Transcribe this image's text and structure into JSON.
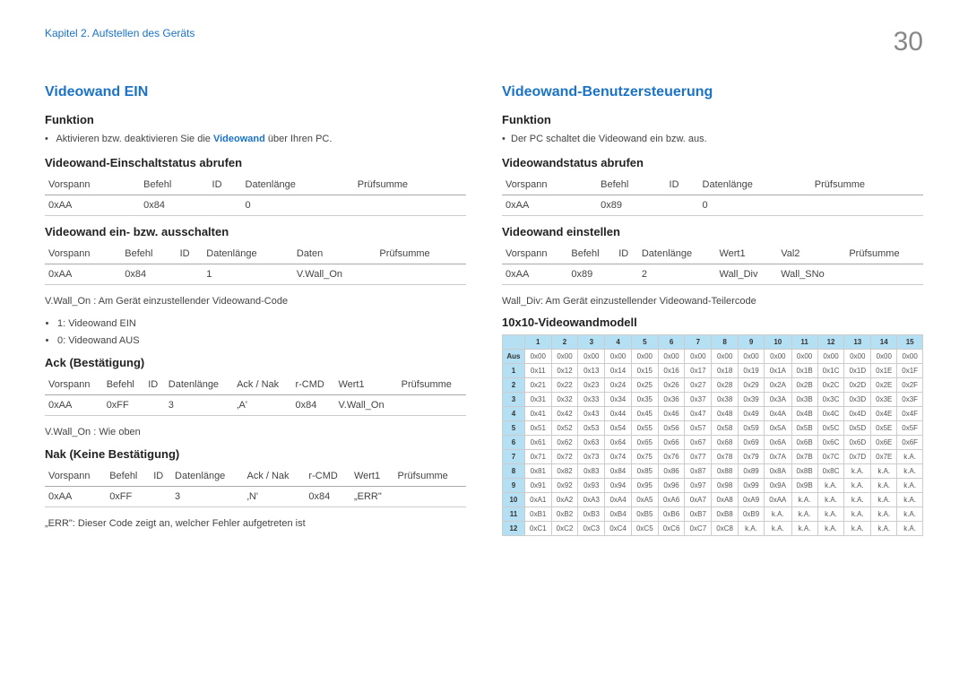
{
  "header": {
    "chapter": "Kapitel 2. Aufstellen des Geräts",
    "page_number": "30"
  },
  "left": {
    "title": "Videowand EIN",
    "funktion_label": "Funktion",
    "funktion_text_pre": "Aktivieren bzw. deaktivieren Sie die ",
    "funktion_link": "Videowand",
    "funktion_text_post": " über Ihren PC.",
    "status_heading": "Videowand-Einschaltstatus abrufen",
    "tbl_status_h": {
      "c1": "Vorspann",
      "c2": "Befehl",
      "c3": "ID",
      "c4": "Datenlänge",
      "c5": "Prüfsumme"
    },
    "tbl_status_r": {
      "c1": "0xAA",
      "c2": "0x84",
      "c3": "",
      "c4": "0",
      "c5": ""
    },
    "onoff_heading": "Videowand ein- bzw. ausschalten",
    "tbl_onoff_h": {
      "c1": "Vorspann",
      "c2": "Befehl",
      "c3": "ID",
      "c4": "Datenlänge",
      "c5": "Daten",
      "c6": "Prüfsumme"
    },
    "tbl_onoff_r": {
      "c1": "0xAA",
      "c2": "0x84",
      "c3": "",
      "c4": "1",
      "c5": "V.Wall_On",
      "c6": ""
    },
    "vwall_note": "V.Wall_On : Am Gerät einzustellender Videowand-Code",
    "bul1": "1: Videowand EIN",
    "bul0": "0: Videowand AUS",
    "ack_heading": "Ack (Bestätigung)",
    "tbl_ack_h": {
      "c1": "Vorspann",
      "c2": "Befehl",
      "c3": "ID",
      "c4": "Datenlänge",
      "c5": "Ack / Nak",
      "c6": "r-CMD",
      "c7": "Wert1",
      "c8": "Prüfsumme"
    },
    "tbl_ack_r": {
      "c1": "0xAA",
      "c2": "0xFF",
      "c3": "",
      "c4": "3",
      "c5": "‚A'",
      "c6": "0x84",
      "c7": "V.Wall_On",
      "c8": ""
    },
    "vwall_above": "V.Wall_On : Wie oben",
    "nak_heading": "Nak (Keine Bestätigung)",
    "tbl_nak_h": {
      "c1": "Vorspann",
      "c2": "Befehl",
      "c3": "ID",
      "c4": "Datenlänge",
      "c5": "Ack / Nak",
      "c6": "r-CMD",
      "c7": "Wert1",
      "c8": "Prüfsumme"
    },
    "tbl_nak_r": {
      "c1": "0xAA",
      "c2": "0xFF",
      "c3": "",
      "c4": "3",
      "c5": "‚N'",
      "c6": "0x84",
      "c7": "„ERR\"",
      "c8": ""
    },
    "err_note": "„ERR\": Dieser Code zeigt an, welcher Fehler aufgetreten ist"
  },
  "right": {
    "title": "Videowand-Benutzersteuerung",
    "funktion_label": "Funktion",
    "funktion_text": "Der PC schaltet die Videowand ein bzw. aus.",
    "status_heading": "Videowandstatus abrufen",
    "tbl_status_h": {
      "c1": "Vorspann",
      "c2": "Befehl",
      "c3": "ID",
      "c4": "Datenlänge",
      "c5": "Prüfsumme"
    },
    "tbl_status_r": {
      "c1": "0xAA",
      "c2": "0x89",
      "c3": "",
      "c4": "0",
      "c5": ""
    },
    "set_heading": "Videowand einstellen",
    "tbl_set_h": {
      "c1": "Vorspann",
      "c2": "Befehl",
      "c3": "ID",
      "c4": "Datenlänge",
      "c5": "Wert1",
      "c6": "Val2",
      "c7": "Prüfsumme"
    },
    "tbl_set_r": {
      "c1": "0xAA",
      "c2": "0x89",
      "c3": "",
      "c4": "2",
      "c5": "Wall_Div",
      "c6": "Wall_SNo",
      "c7": ""
    },
    "walldiv_note": "Wall_Div: Am Gerät einzustellender Videowand-Teilercode",
    "model_heading": "10x10-Videowandmodell"
  },
  "chart_data": {
    "type": "table",
    "title": "10x10-Videowandmodell",
    "columns": [
      "1",
      "2",
      "3",
      "4",
      "5",
      "6",
      "7",
      "8",
      "9",
      "10",
      "11",
      "12",
      "13",
      "14",
      "15"
    ],
    "rows": [
      {
        "label": "Aus",
        "cells": [
          "0x00",
          "0x00",
          "0x00",
          "0x00",
          "0x00",
          "0x00",
          "0x00",
          "0x00",
          "0x00",
          "0x00",
          "0x00",
          "0x00",
          "0x00",
          "0x00",
          "0x00"
        ]
      },
      {
        "label": "1",
        "cells": [
          "0x11",
          "0x12",
          "0x13",
          "0x14",
          "0x15",
          "0x16",
          "0x17",
          "0x18",
          "0x19",
          "0x1A",
          "0x1B",
          "0x1C",
          "0x1D",
          "0x1E",
          "0x1F"
        ]
      },
      {
        "label": "2",
        "cells": [
          "0x21",
          "0x22",
          "0x23",
          "0x24",
          "0x25",
          "0x26",
          "0x27",
          "0x28",
          "0x29",
          "0x2A",
          "0x2B",
          "0x2C",
          "0x2D",
          "0x2E",
          "0x2F"
        ]
      },
      {
        "label": "3",
        "cells": [
          "0x31",
          "0x32",
          "0x33",
          "0x34",
          "0x35",
          "0x36",
          "0x37",
          "0x38",
          "0x39",
          "0x3A",
          "0x3B",
          "0x3C",
          "0x3D",
          "0x3E",
          "0x3F"
        ]
      },
      {
        "label": "4",
        "cells": [
          "0x41",
          "0x42",
          "0x43",
          "0x44",
          "0x45",
          "0x46",
          "0x47",
          "0x48",
          "0x49",
          "0x4A",
          "0x4B",
          "0x4C",
          "0x4D",
          "0x4E",
          "0x4F"
        ]
      },
      {
        "label": "5",
        "cells": [
          "0x51",
          "0x52",
          "0x53",
          "0x54",
          "0x55",
          "0x56",
          "0x57",
          "0x58",
          "0x59",
          "0x5A",
          "0x5B",
          "0x5C",
          "0x5D",
          "0x5E",
          "0x5F"
        ]
      },
      {
        "label": "6",
        "cells": [
          "0x61",
          "0x62",
          "0x63",
          "0x64",
          "0x65",
          "0x66",
          "0x67",
          "0x68",
          "0x69",
          "0x6A",
          "0x6B",
          "0x6C",
          "0x6D",
          "0x6E",
          "0x6F"
        ]
      },
      {
        "label": "7",
        "cells": [
          "0x71",
          "0x72",
          "0x73",
          "0x74",
          "0x75",
          "0x76",
          "0x77",
          "0x78",
          "0x79",
          "0x7A",
          "0x7B",
          "0x7C",
          "0x7D",
          "0x7E",
          "k.A."
        ]
      },
      {
        "label": "8",
        "cells": [
          "0x81",
          "0x82",
          "0x83",
          "0x84",
          "0x85",
          "0x86",
          "0x87",
          "0x88",
          "0x89",
          "0x8A",
          "0x8B",
          "0x8C",
          "k.A.",
          "k.A.",
          "k.A."
        ]
      },
      {
        "label": "9",
        "cells": [
          "0x91",
          "0x92",
          "0x93",
          "0x94",
          "0x95",
          "0x96",
          "0x97",
          "0x98",
          "0x99",
          "0x9A",
          "0x9B",
          "k.A.",
          "k.A.",
          "k.A.",
          "k.A."
        ]
      },
      {
        "label": "10",
        "cells": [
          "0xA1",
          "0xA2",
          "0xA3",
          "0xA4",
          "0xA5",
          "0xA6",
          "0xA7",
          "0xA8",
          "0xA9",
          "0xAA",
          "k.A.",
          "k.A.",
          "k.A.",
          "k.A.",
          "k.A."
        ]
      },
      {
        "label": "11",
        "cells": [
          "0xB1",
          "0xB2",
          "0xB3",
          "0xB4",
          "0xB5",
          "0xB6",
          "0xB7",
          "0xB8",
          "0xB9",
          "k.A.",
          "k.A.",
          "k.A.",
          "k.A.",
          "k.A.",
          "k.A."
        ]
      },
      {
        "label": "12",
        "cells": [
          "0xC1",
          "0xC2",
          "0xC3",
          "0xC4",
          "0xC5",
          "0xC6",
          "0xC7",
          "0xC8",
          "k.A.",
          "k.A.",
          "k.A.",
          "k.A.",
          "k.A.",
          "k.A.",
          "k.A."
        ]
      }
    ]
  }
}
